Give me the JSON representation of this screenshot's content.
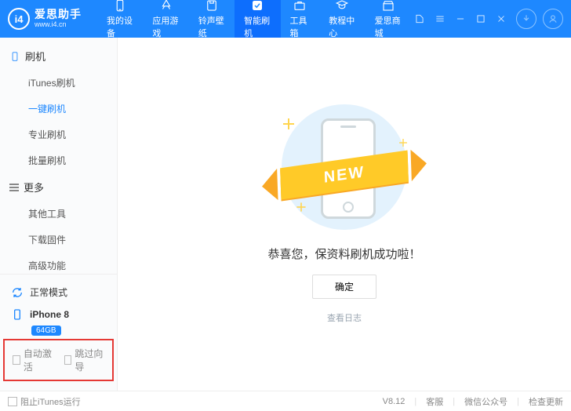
{
  "app": {
    "name": "爱思助手",
    "name_en": "www.i4.cn",
    "logo_letters": "i4"
  },
  "nav": [
    {
      "label": "我的设备",
      "icon": "device"
    },
    {
      "label": "应用游戏",
      "icon": "apps"
    },
    {
      "label": "铃声壁纸",
      "icon": "music"
    },
    {
      "label": "智能刷机",
      "icon": "flash",
      "active": true
    },
    {
      "label": "工具箱",
      "icon": "toolbox"
    },
    {
      "label": "教程中心",
      "icon": "tutorial"
    },
    {
      "label": "爱思商城",
      "icon": "shop"
    }
  ],
  "sidebar": {
    "groups": [
      {
        "title": "刷机",
        "icon": "device",
        "items": [
          "iTunes刷机",
          "一键刷机",
          "专业刷机",
          "批量刷机"
        ],
        "activeIndex": 1
      },
      {
        "title": "更多",
        "icon": "menu",
        "items": [
          "其他工具",
          "下载固件",
          "高级功能"
        ],
        "activeIndex": -1
      }
    ],
    "mode": {
      "label": "正常模式"
    },
    "device": {
      "name": "iPhone 8",
      "storage": "64GB"
    },
    "checks": [
      {
        "label": "自动激活"
      },
      {
        "label": "跳过向导"
      }
    ]
  },
  "content": {
    "banner_text": "NEW",
    "success_text": "恭喜您，保资料刷机成功啦！",
    "confirm_label": "确定",
    "log_link": "查看日志"
  },
  "statusbar": {
    "block_itunes": "阻止iTunes运行",
    "version": "V8.12",
    "support": "客服",
    "wechat": "微信公众号",
    "update": "检查更新"
  }
}
